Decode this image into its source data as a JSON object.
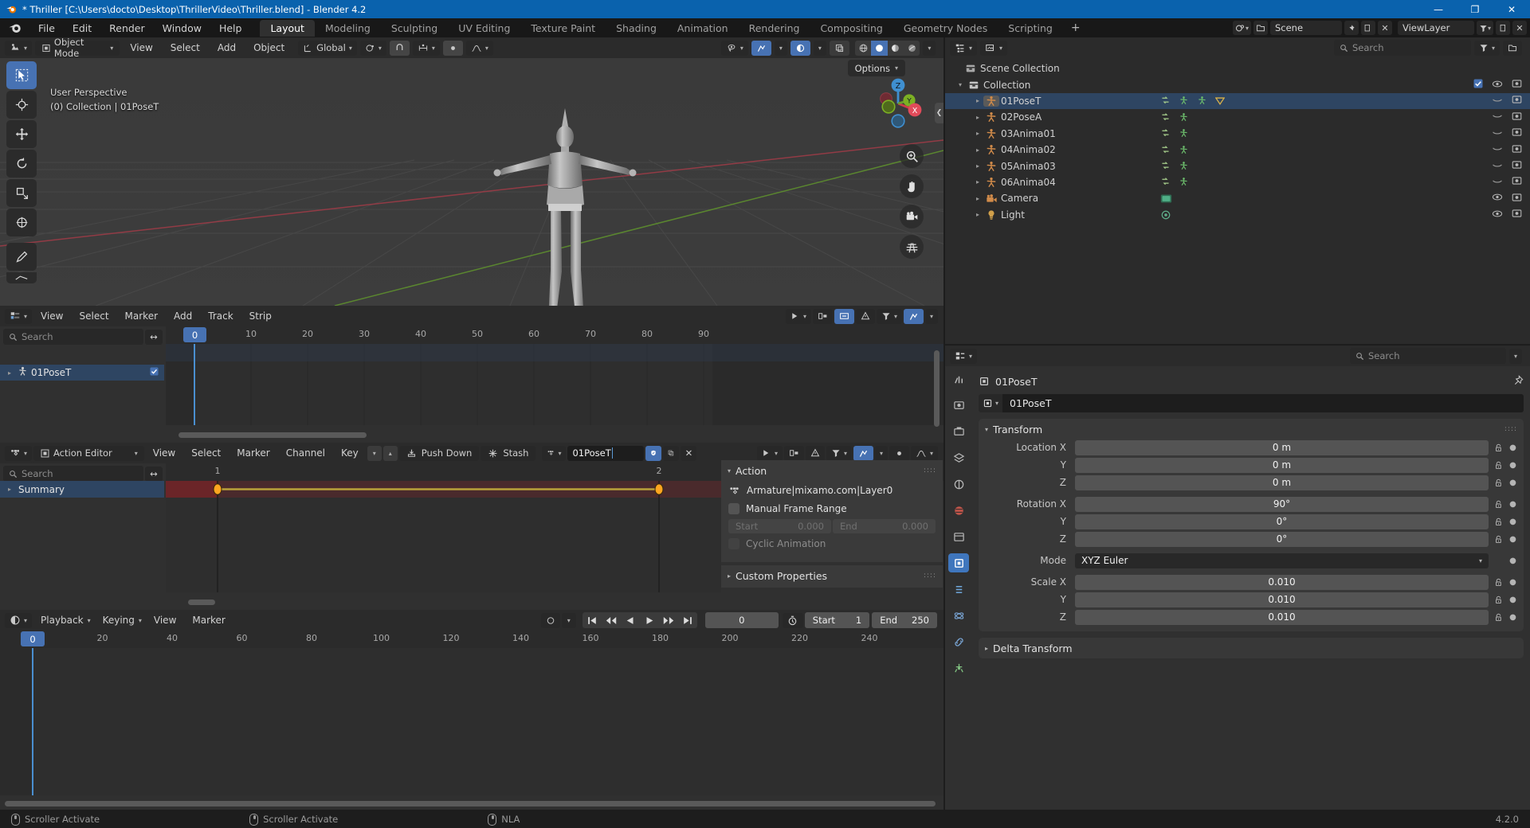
{
  "window": {
    "title": "* Thriller [C:\\Users\\docto\\Desktop\\ThrillerVideo\\Thriller.blend] - Blender 4.2",
    "minimize": "—",
    "maximize": "❐",
    "close": "✕"
  },
  "menubar": {
    "items": [
      "File",
      "Edit",
      "Render",
      "Window",
      "Help"
    ],
    "workspaces": [
      {
        "label": "Layout",
        "active": true
      },
      {
        "label": "Modeling",
        "active": false
      },
      {
        "label": "Sculpting",
        "active": false
      },
      {
        "label": "UV Editing",
        "active": false
      },
      {
        "label": "Texture Paint",
        "active": false
      },
      {
        "label": "Shading",
        "active": false
      },
      {
        "label": "Animation",
        "active": false
      },
      {
        "label": "Rendering",
        "active": false
      },
      {
        "label": "Compositing",
        "active": false
      },
      {
        "label": "Geometry Nodes",
        "active": false
      },
      {
        "label": "Scripting",
        "active": false
      }
    ],
    "add_workspace": "+",
    "scene_name": "Scene",
    "viewlayer_name": "ViewLayer"
  },
  "viewport": {
    "mode": "Object Mode",
    "menus": [
      "View",
      "Select",
      "Add",
      "Object"
    ],
    "transform_orientation": "Global",
    "options_label": "Options",
    "overlay_text_line1": "User Perspective",
    "overlay_text_line2": "(0) Collection | 01PoseT",
    "gizmo_axes": [
      "Z",
      "Y",
      "X"
    ],
    "nav_icons": [
      "zoom-icon",
      "hand-icon",
      "camera-icon",
      "grid-icon"
    ],
    "toolbar_icons": [
      "tweak-select-icon",
      "cursor-icon",
      "move-icon",
      "rotate-icon",
      "scale-icon",
      "transform-icon",
      "annotate-icon",
      "measure-icon"
    ],
    "shading_modes": [
      "wireframe",
      "solid",
      "material",
      "rendered"
    ],
    "active_shading": "solid"
  },
  "outliner": {
    "search_placeholder": "Search",
    "scene_collection": "Scene Collection",
    "collection": "Collection",
    "items": [
      {
        "name": "01PoseT",
        "icon": "armature-icon",
        "selected": true,
        "indent": 2,
        "modifiers": 3
      },
      {
        "name": "02PoseA",
        "icon": "armature-icon",
        "selected": false,
        "indent": 2,
        "modifiers": 2
      },
      {
        "name": "03Anima01",
        "icon": "armature-icon",
        "selected": false,
        "indent": 2,
        "modifiers": 2
      },
      {
        "name": "04Anima02",
        "icon": "armature-icon",
        "selected": false,
        "indent": 2,
        "modifiers": 2
      },
      {
        "name": "05Anima03",
        "icon": "armature-icon",
        "selected": false,
        "indent": 2,
        "modifiers": 2
      },
      {
        "name": "06Anima04",
        "icon": "armature-icon",
        "selected": false,
        "indent": 2,
        "modifiers": 2
      },
      {
        "name": "Camera",
        "icon": "camera-icon",
        "selected": false,
        "indent": 2,
        "modifiers": 0
      },
      {
        "name": "Light",
        "icon": "light-icon",
        "selected": false,
        "indent": 2,
        "modifiers": 0
      }
    ]
  },
  "properties": {
    "search_placeholder": "Search",
    "breadcrumb_object": "01PoseT",
    "object_name": "01PoseT",
    "transform_title": "Transform",
    "rows": [
      {
        "label": "Location X",
        "value": "0 m",
        "type": "num"
      },
      {
        "label": "Y",
        "value": "0 m",
        "type": "num"
      },
      {
        "label": "Z",
        "value": "0 m",
        "type": "num"
      },
      {
        "label": "Rotation X",
        "value": "90°",
        "type": "num"
      },
      {
        "label": "Y",
        "value": "0°",
        "type": "num"
      },
      {
        "label": "Z",
        "value": "0°",
        "type": "num"
      },
      {
        "label": "Mode",
        "value": "XYZ Euler",
        "type": "dropdown"
      },
      {
        "label": "Scale X",
        "value": "0.010",
        "type": "num"
      },
      {
        "label": "Y",
        "value": "0.010",
        "type": "num"
      },
      {
        "label": "Z",
        "value": "0.010",
        "type": "num"
      }
    ],
    "delta_transform": "Delta Transform"
  },
  "nla": {
    "menus": [
      "View",
      "Select",
      "Marker",
      "Add",
      "Track",
      "Strip"
    ],
    "search_placeholder": "Search",
    "channel_name": "01PoseT",
    "ticks": [
      0,
      10,
      20,
      30,
      40,
      50,
      60,
      70,
      80,
      90
    ],
    "playhead_frame": 0
  },
  "dopesheet": {
    "editor_mode": "Action Editor",
    "menus": [
      "View",
      "Select",
      "Marker",
      "Channel",
      "Key"
    ],
    "push_down": "Push Down",
    "stash": "Stash",
    "action_name": "01PoseT",
    "search_placeholder": "Search",
    "summary_label": "Summary",
    "ticks": [
      1,
      2
    ],
    "keyframes": [
      1,
      2
    ]
  },
  "action_panel": {
    "title": "Action",
    "action_datablock": "Armature|mixamo.com|Layer0",
    "manual_frame_range": "Manual Frame Range",
    "start_label": "Start",
    "start_value": "0.000",
    "end_label": "End",
    "end_value": "0.000",
    "cyclic_animation": "Cyclic Animation",
    "custom_properties": "Custom Properties"
  },
  "timeline": {
    "menus_dd": [
      "Playback",
      "Keying"
    ],
    "menus": [
      "View",
      "Marker"
    ],
    "current_frame": "0",
    "start_label": "Start",
    "start_value": "1",
    "end_label": "End",
    "end_value": "250",
    "ticks": [
      0,
      20,
      40,
      60,
      80,
      100,
      120,
      140,
      160,
      180,
      200,
      220,
      240
    ],
    "playback_icons": [
      "jump-start-icon",
      "prev-keyframe-icon",
      "play-reverse-icon",
      "play-icon",
      "next-keyframe-icon",
      "jump-end-icon"
    ]
  },
  "statusbar": {
    "items": [
      {
        "icon": "mouse-icon",
        "label": "Scroller Activate"
      },
      {
        "icon": "mouse-icon",
        "label": "Scroller Activate"
      },
      {
        "icon": "mouse-icon",
        "label": "NLA"
      }
    ],
    "version": "4.2.0"
  },
  "colors": {
    "accent": "#4772b3",
    "title_bar": "#0a62ad",
    "keyframe": "#ffa520",
    "selected_row": "#2e4562",
    "armature_icon": "#d18b4a"
  }
}
